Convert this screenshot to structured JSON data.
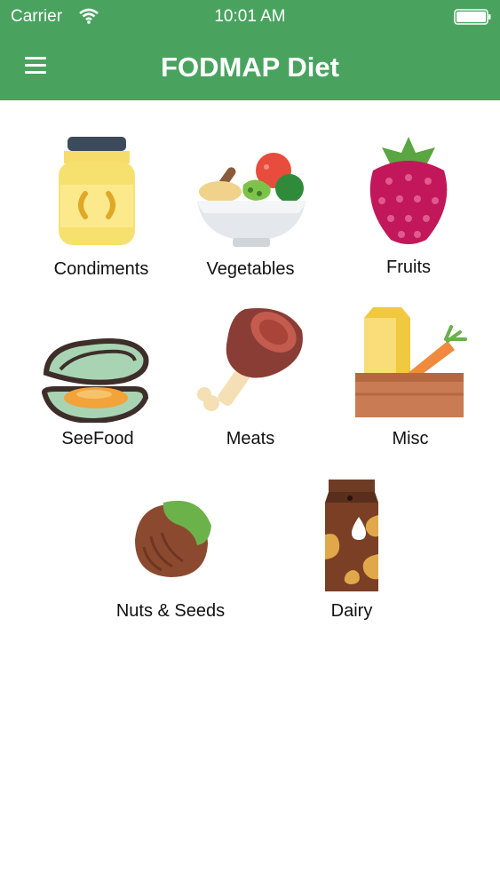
{
  "status_bar": {
    "carrier": "Carrier",
    "time": "10:01 AM"
  },
  "header": {
    "title": "FODMAP Diet"
  },
  "categories": [
    {
      "label": "Condiments",
      "icon": "jar-icon"
    },
    {
      "label": "Vegetables",
      "icon": "salad-bowl-icon"
    },
    {
      "label": "Fruits",
      "icon": "raspberry-icon"
    },
    {
      "label": "SeeFood",
      "icon": "mussel-icon"
    },
    {
      "label": "Meats",
      "icon": "ham-leg-icon"
    },
    {
      "label": "Misc",
      "icon": "grocery-crate-icon"
    },
    {
      "label": "Nuts & Seeds",
      "icon": "hazelnut-icon"
    },
    {
      "label": "Dairy",
      "icon": "milk-carton-icon"
    }
  ]
}
